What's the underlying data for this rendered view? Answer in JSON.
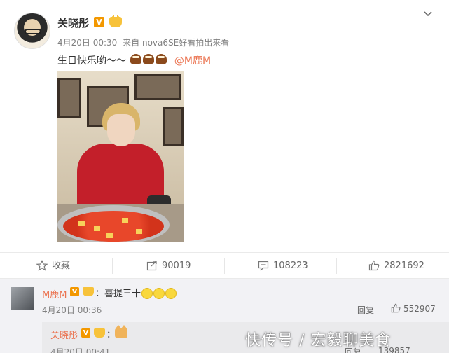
{
  "post": {
    "username": "关晓彤",
    "verified_badge": "V",
    "timestamp": "4月20日 00:30",
    "source_prefix": "来自",
    "source": "nova6SE好看拍出来看",
    "text": "生日快乐哟～～",
    "mention": "@M鹿M"
  },
  "actions": {
    "favorite_label": "收藏",
    "share_count": "90019",
    "comment_count": "108223",
    "like_count": "2821692"
  },
  "comment": {
    "username": "M鹿M",
    "verified_badge": "V",
    "text": "：喜提三十",
    "timestamp": "4月20日 00:36",
    "reply_label": "回复",
    "like_count": "552907"
  },
  "reply": {
    "username": "关晓彤",
    "verified_badge": "V",
    "colon": "：",
    "timestamp": "4月20日 00:41",
    "reply_label": "回复",
    "like_count": "139857"
  },
  "watermark": "快传号 / 宏毅聊美食",
  "colors": {
    "accent": "#eb7350",
    "verified": "#f39800",
    "muted": "#808080"
  },
  "icons": [
    "chevron-down-icon",
    "star-icon",
    "share-icon",
    "comment-icon",
    "thumbs-up-icon",
    "cake-emoji",
    "smile-emoji",
    "cat-emoji",
    "crown-icon"
  ]
}
